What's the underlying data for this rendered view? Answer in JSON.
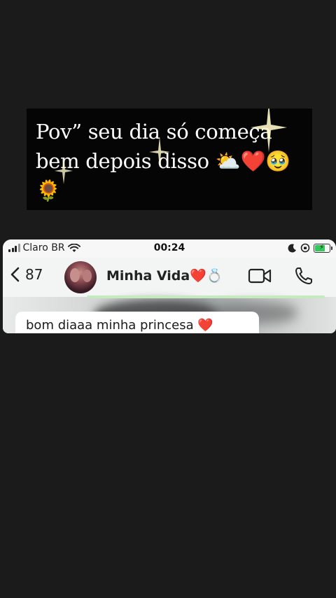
{
  "caption": {
    "line1": "Pov” seu dia só começa",
    "line2": "bem depois disso ⛅❤️🥹",
    "line3": "🌻"
  },
  "status_bar": {
    "carrier": "Claro BR",
    "time": "00:24",
    "battery_level": 0.75,
    "battery_color": "#34c759"
  },
  "chat_header": {
    "back_count": "87",
    "contact_name": "Minha Vida❤️💍"
  },
  "messages": [
    {
      "text": "bom diaaa minha princesa ❤️",
      "direction": "incoming"
    }
  ]
}
